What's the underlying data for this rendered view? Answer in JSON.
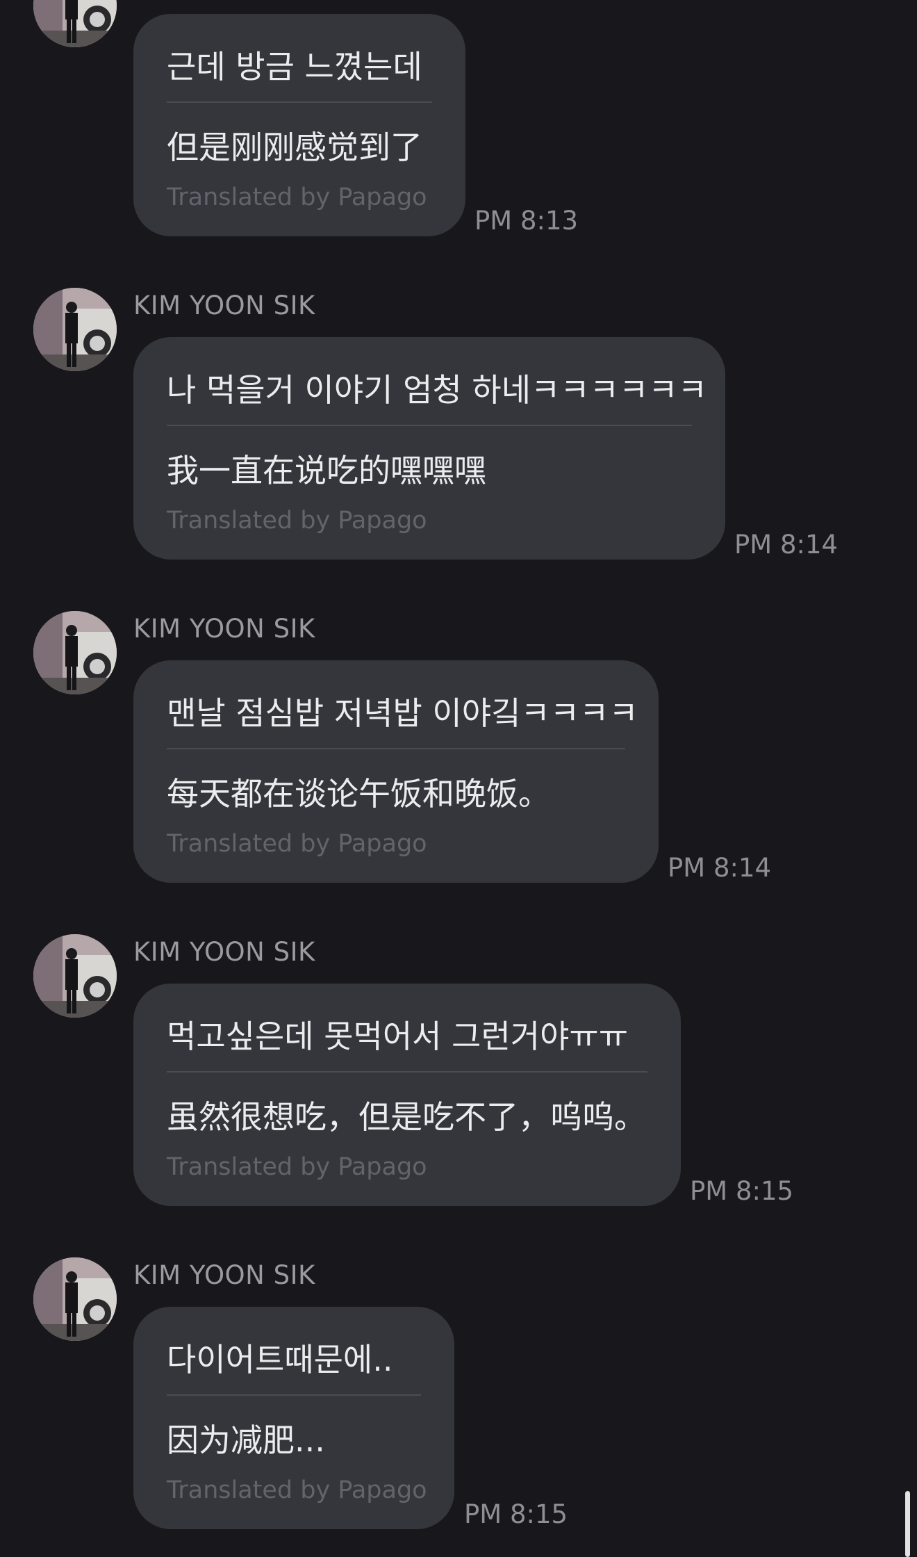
{
  "messages": [
    {
      "sender": "",
      "original": "근데 방금 느꼈는데",
      "translation": "但是刚刚感觉到了",
      "credit": "Translated by Papago",
      "time": "PM 8:13"
    },
    {
      "sender": "KIM YOON SIK",
      "original": "나 먹을거 이야기 엄청 하네ㅋㅋㅋㅋㅋㅋ",
      "translation": "我一直在说吃的嘿嘿嘿",
      "credit": "Translated by Papago",
      "time": "PM 8:14"
    },
    {
      "sender": "KIM YOON SIK",
      "original": "맨날 점심밥 저녁밥 이야깈ㅋㅋㅋㅋ",
      "translation": "每天都在谈论午饭和晚饭。",
      "credit": "Translated by Papago",
      "time": "PM 8:14"
    },
    {
      "sender": "KIM YOON SIK",
      "original": "먹고싶은데 못먹어서 그런거야ㅠㅠ",
      "translation": "虽然很想吃，但是吃不了，呜呜。",
      "credit": "Translated by Papago",
      "time": "PM 8:15"
    },
    {
      "sender": "KIM YOON SIK",
      "original": "다이어트때문에..",
      "translation": "因为减肥...",
      "credit": "Translated by Papago",
      "time": "PM 8:15"
    }
  ],
  "icons": {
    "avatar": "profile-photo-icon",
    "scrollbar": "scrollbar-thumb"
  },
  "colors": {
    "background": "#18181c",
    "bubble": "#35363c",
    "text": "#ececef",
    "secondary_text": "#9a9aa0",
    "credit_text": "#63646b"
  }
}
